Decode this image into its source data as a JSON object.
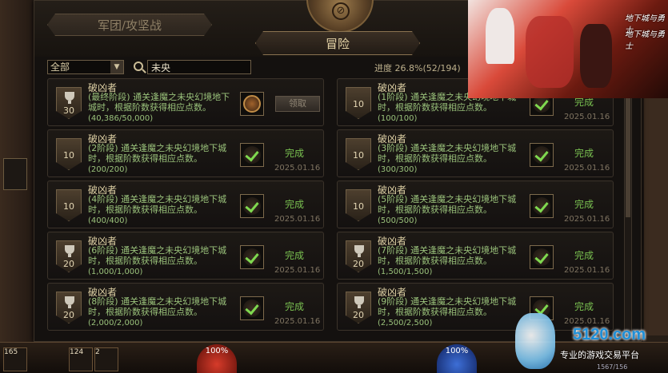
{
  "window": {
    "top_tab": "军团/攻坚战",
    "active_tab": "冒险"
  },
  "filter": {
    "category": "全部",
    "search_value": "未央",
    "progress": "进度 26.8%(52/194)"
  },
  "cards": [
    {
      "title": "破凶者",
      "desc": "(最终阶段) 通关逢魔之未央幻境地下城时，根据阶数获得相应点数。",
      "progress": "(40,386/50,000)",
      "points": "30",
      "trophy": true,
      "completed": false,
      "button": "领取"
    },
    {
      "title": "破凶者",
      "desc": "(1阶段) 通关逢魔之未央幻境地下城时，根据阶数获得相应点数。",
      "progress": "(100/100)",
      "points": "10",
      "trophy": false,
      "completed": true,
      "status": "完成",
      "date": "2025.01.16"
    },
    {
      "title": "破凶者",
      "desc": "(2阶段) 通关逢魔之未央幻境地下城时，根据阶数获得相应点数。",
      "progress": "(200/200)",
      "points": "10",
      "trophy": false,
      "completed": true,
      "status": "完成",
      "date": "2025.01.16"
    },
    {
      "title": "破凶者",
      "desc": "(3阶段) 通关逢魔之未央幻境地下城时，根据阶数获得相应点数。",
      "progress": "(300/300)",
      "points": "10",
      "trophy": false,
      "completed": true,
      "status": "完成",
      "date": "2025.01.16"
    },
    {
      "title": "破凶者",
      "desc": "(4阶段) 通关逢魔之未央幻境地下城时，根据阶数获得相应点数。",
      "progress": "(400/400)",
      "points": "10",
      "trophy": false,
      "completed": true,
      "status": "完成",
      "date": "2025.01.16"
    },
    {
      "title": "破凶者",
      "desc": "(5阶段) 通关逢魔之未央幻境地下城时，根据阶数获得相应点数。",
      "progress": "(500/500)",
      "points": "10",
      "trophy": false,
      "completed": true,
      "status": "完成",
      "date": "2025.01.16"
    },
    {
      "title": "破凶者",
      "desc": "(6阶段) 通关逢魔之未央幻境地下城时，根据阶数获得相应点数。",
      "progress": "(1,000/1,000)",
      "points": "20",
      "trophy": true,
      "completed": true,
      "status": "完成",
      "date": "2025.01.16"
    },
    {
      "title": "破凶者",
      "desc": "(7阶段) 通关逢魔之未央幻境地下城时，根据阶数获得相应点数。",
      "progress": "(1,500/1,500)",
      "points": "20",
      "trophy": true,
      "completed": true,
      "status": "完成",
      "date": "2025.01.16"
    },
    {
      "title": "破凶者",
      "desc": "(8阶段) 通关逢魔之未央幻境地下城时，根据阶数获得相应点数。",
      "progress": "(2,000/2,000)",
      "points": "20",
      "trophy": true,
      "completed": true,
      "status": "完成",
      "date": "2025.01.16"
    },
    {
      "title": "破凶者",
      "desc": "(9阶段) 通关逢魔之未央幻境地下城时，根据阶数获得相应点数。",
      "progress": "(2,500/2,500)",
      "points": "20",
      "trophy": true,
      "completed": true,
      "status": "完成",
      "date": "2025.01.16"
    }
  ],
  "hud": {
    "hp": "100%",
    "mp": "100%",
    "slot1": "165",
    "slot2": "124",
    "slot3": "2",
    "coords": "1567/156"
  },
  "watermark": {
    "site": "5120.com",
    "slogan": "专业的游戏交易平台"
  },
  "promo": {
    "logo1": "地下城与勇士",
    "logo2": "地下城与勇士"
  }
}
